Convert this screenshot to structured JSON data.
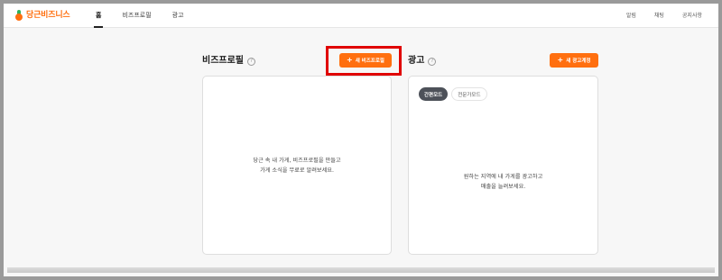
{
  "brand": {
    "logo_text": "당근비즈니스"
  },
  "nav": {
    "items": [
      {
        "label": "홈",
        "active": true
      },
      {
        "label": "비즈프로필",
        "active": false
      },
      {
        "label": "광고",
        "active": false
      }
    ]
  },
  "right_nav": {
    "items": [
      "알림",
      "채팅",
      "공지사항"
    ]
  },
  "biz_profile": {
    "title": "비즈프로필",
    "button_label": "새 비즈프로필",
    "empty_lines": [
      "당근 속 내 가게, 비즈프로필을 만들고",
      "가게 소식을 무료로 알려보세요."
    ]
  },
  "ads": {
    "title": "광고",
    "button_label": "새 광고계정",
    "tabs": [
      {
        "label": "간편모드",
        "active": true
      },
      {
        "label": "전문가모드",
        "active": false
      }
    ],
    "empty_lines": [
      "원하는 지역에 내 가게를 광고하고",
      "매출을 늘려보세요."
    ]
  },
  "help_icon_glyph": "?",
  "plus_glyph": "+",
  "colors": {
    "accent": "#ff6f0f",
    "highlight": "#e00000",
    "pill_active": "#4d5159"
  }
}
